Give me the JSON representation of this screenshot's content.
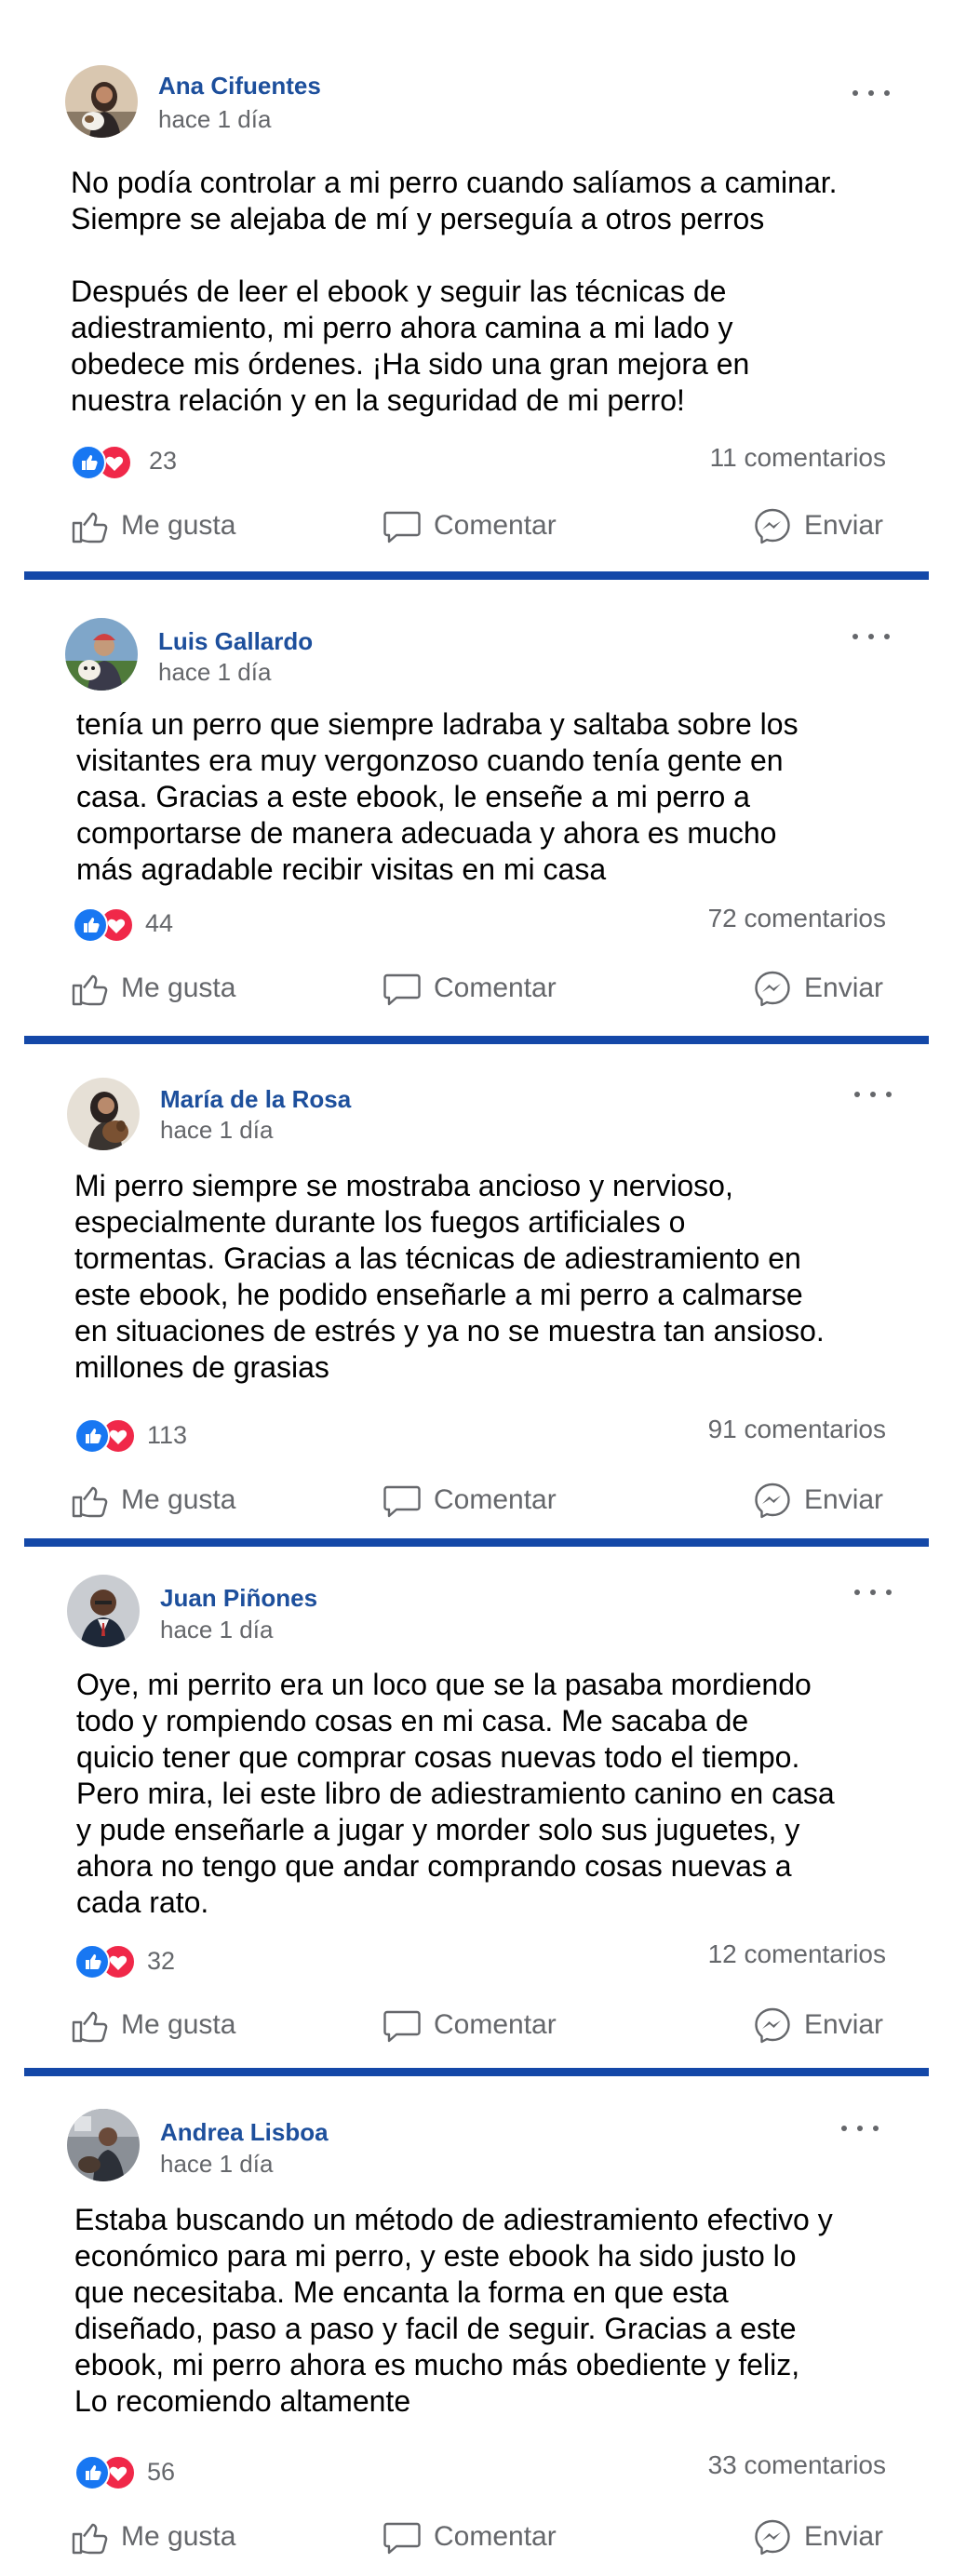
{
  "posts": [
    {
      "author": "Ana Cifuentes",
      "time": "hace 1 día",
      "avatar_icon": "avatar-woman-with-dog",
      "body": "No podía controlar a mi perro cuando salíamos a caminar.\nSiempre se alejaba de mí y perseguía a otros perros\n\nDespués de leer el ebook y seguir las técnicas de\nadiestramiento, mi perro ahora camina a mi lado y\nobedece mis órdenes. ¡Ha sido una gran mejora en\nnuestra relación y en la seguridad de mi perro!",
      "reactions": "23",
      "comments": "11 comentarios"
    },
    {
      "author": "Luis Gallardo",
      "time": "hace 1 día",
      "avatar_icon": "avatar-man-with-dog",
      "body": "tenía un perro que siempre ladraba y saltaba sobre los\nvisitantes era muy vergonzoso cuando tenía gente en\ncasa. Gracias a este ebook, le enseñe a mi perro a\ncomportarse de manera adecuada y ahora es mucho\nmás agradable recibir visitas en mi casa",
      "reactions": "44",
      "comments": "72 comentarios"
    },
    {
      "author": "María de la Rosa",
      "time": "hace 1 día",
      "avatar_icon": "avatar-woman-with-dog",
      "body": "Mi perro siempre se mostraba ancioso y nervioso,\nespecialmente durante los fuegos artificiales o\ntormentas. Gracias a las técnicas de adiestramiento en\neste ebook, he podido enseñarle a mi perro a calmarse\nen situaciones de estrés y ya no se muestra tan ansioso.\nmillones de grasias",
      "reactions": "113",
      "comments": "91 comentarios"
    },
    {
      "author": "Juan Piñones",
      "time": "hace 1 día",
      "avatar_icon": "avatar-man",
      "body": "Oye, mi perrito era un loco que se la pasaba mordiendo\ntodo y rompiendo cosas en mi casa. Me sacaba de\nquicio tener que comprar cosas nuevas todo el tiempo.\nPero mira, lei este libro de adiestramiento canino en casa\ny pude enseñarle a jugar y morder solo sus juguetes, y\nahora no tengo que andar comprando cosas nuevas a\ncada rato.",
      "reactions": "32",
      "comments": "12 comentarios"
    },
    {
      "author": "Andrea Lisboa",
      "time": "hace 1 día",
      "avatar_icon": "avatar-person-with-dog",
      "body": "Estaba buscando un método de adiestramiento efectivo y\neconómico para mi perro, y este ebook ha sido justo lo\nque necesitaba. Me encanta la forma en que esta\ndiseñado, paso a paso y facil de seguir. Gracias a este\nebook, mi perro ahora es mucho más obediente y feliz,\nLo recomiendo altamente",
      "reactions": "56",
      "comments": "33 comentarios"
    }
  ],
  "actions": {
    "like_label": "Me gusta",
    "comment_label": "Comentar",
    "send_label": "Enviar",
    "like_icon": "thumbs-up-outline-icon",
    "comment_icon": "comment-bubble-icon",
    "send_icon": "messenger-icon"
  },
  "colors": {
    "author_blue": "#1d4f9c",
    "divider_blue": "#1448a8",
    "like_blue": "#1877f2",
    "love_red": "#f02849",
    "meta_gray": "#65676b"
  }
}
